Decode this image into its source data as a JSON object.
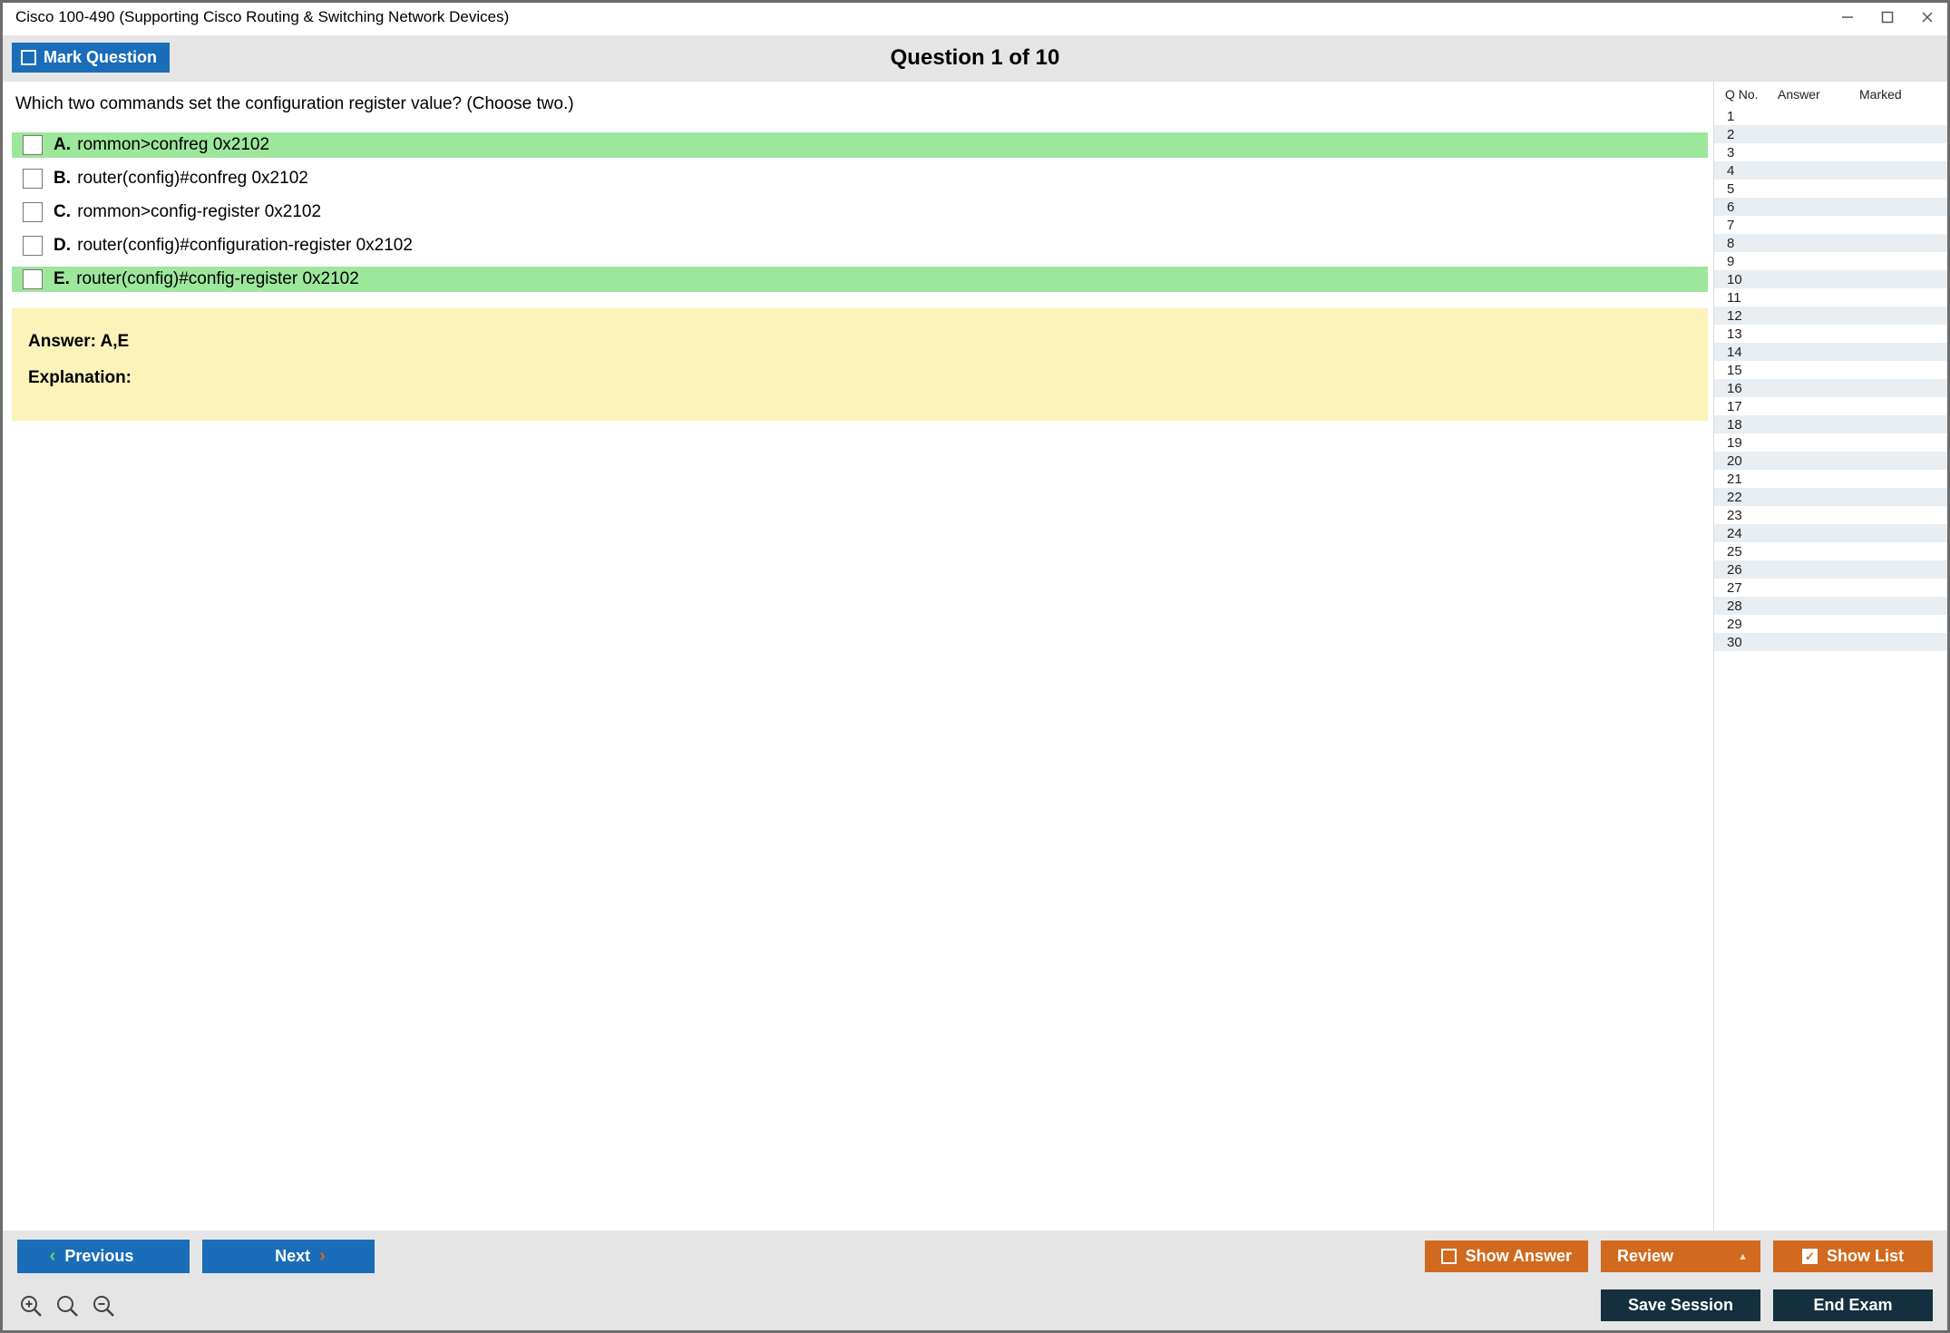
{
  "window": {
    "title": "Cisco 100-490 (Supporting Cisco Routing & Switching Network Devices)"
  },
  "header": {
    "mark_label": "Mark Question",
    "q_title": "Question 1 of 10"
  },
  "question": {
    "text": "Which two commands set the configuration register value? (Choose two.)",
    "options": [
      {
        "letter": "A.",
        "text": "rommon>confreg 0x2102",
        "correct": true
      },
      {
        "letter": "B.",
        "text": "router(config)#confreg 0x2102",
        "correct": false
      },
      {
        "letter": "C.",
        "text": "rommon>config-register 0x2102",
        "correct": false
      },
      {
        "letter": "D.",
        "text": "router(config)#configuration-register 0x2102",
        "correct": false
      },
      {
        "letter": "E.",
        "text": "router(config)#config-register 0x2102",
        "correct": true
      }
    ],
    "answer_line": "Answer: A,E",
    "explanation_label": "Explanation:"
  },
  "list": {
    "head": {
      "qno": "Q No.",
      "answer": "Answer",
      "marked": "Marked"
    },
    "rows": [
      1,
      2,
      3,
      4,
      5,
      6,
      7,
      8,
      9,
      10,
      11,
      12,
      13,
      14,
      15,
      16,
      17,
      18,
      19,
      20,
      21,
      22,
      23,
      24,
      25,
      26,
      27,
      28,
      29,
      30
    ]
  },
  "bottombar": {
    "previous": "Previous",
    "next": "Next",
    "show_answer": "Show Answer",
    "review": "Review",
    "show_list": "Show List",
    "save_session": "Save Session",
    "end_exam": "End Exam"
  }
}
